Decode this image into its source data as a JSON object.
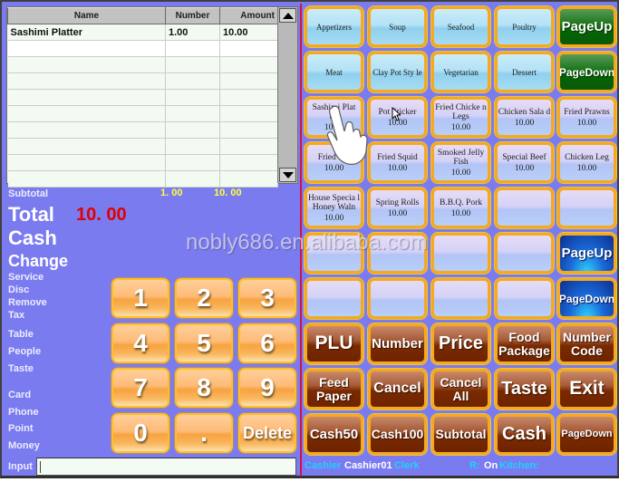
{
  "order_grid": {
    "columns": [
      "Name",
      "Number",
      "Amount"
    ],
    "rows": [
      {
        "name": "Sashimi Platter",
        "number": "1.00",
        "amount": "10.00"
      }
    ],
    "empty_rows": 9
  },
  "summary": {
    "subtotal_label": "Subtotal",
    "subtotal_number": "1. 00",
    "subtotal_amount": "10. 00",
    "total_label": "Total",
    "total_value": "10. 00",
    "cash_label": "Cash",
    "change_label": "Change"
  },
  "side_labels": [
    "Service",
    "Disc",
    "Remove",
    "Tax",
    "Table",
    "People",
    "Taste",
    "Card",
    "Phone",
    "Point",
    "Money"
  ],
  "numpad": [
    "1",
    "2",
    "3",
    "4",
    "5",
    "6",
    "7",
    "8",
    "9",
    "0",
    ".",
    "Delete"
  ],
  "input": {
    "label": "Input",
    "value": ""
  },
  "categories": [
    "Appetizers",
    "Soup",
    "Seafood",
    "Poultry",
    "Meat",
    "Clay Pot Sty le",
    "Vegetarian",
    "Dessert"
  ],
  "category_nav": {
    "page_up": "PageUp",
    "page_down": "PageDown"
  },
  "items": [
    {
      "name": "Sashimi Plat ter",
      "price": "10.00"
    },
    {
      "name": "Pot Sticker",
      "price": "10.00"
    },
    {
      "name": "Fried Chicke n Legs",
      "price": "10.00"
    },
    {
      "name": "Chicken Sala d",
      "price": "10.00"
    },
    {
      "name": "Fried Prawns",
      "price": "10.00"
    },
    {
      "name": "Fried ... s",
      "price": "10.00"
    },
    {
      "name": "Fried Squid",
      "price": "10.00"
    },
    {
      "name": "Smoked Jelly Fish",
      "price": "10.00"
    },
    {
      "name": "Special Beef",
      "price": "10.00"
    },
    {
      "name": "Chicken Leg",
      "price": "10.00"
    },
    {
      "name": "House Specia l Honey Waln",
      "price": "10.00"
    },
    {
      "name": "Spring Rolls",
      "price": "10.00"
    },
    {
      "name": "B.B.Q. Pork",
      "price": "10.00"
    }
  ],
  "item_nav": {
    "page_up": "PageUp",
    "page_down": "PageDown"
  },
  "functions": [
    [
      "PLU",
      "Number",
      "Price",
      "Food Package",
      "Number Code"
    ],
    [
      "Feed Paper",
      "Cancel",
      "Cancel All",
      "Taste",
      "Exit"
    ],
    [
      "Cash50",
      "Cash100",
      "Subtotal",
      "Cash",
      "PageDown"
    ]
  ],
  "status_bar": {
    "cashier_label": "Cashier",
    "cashier_value": "Cashier01",
    "clerk_label": "Clerk",
    "r_label": "R:",
    "r_value": "On",
    "kitchen_label": "Kitchen:"
  },
  "watermark": "nobly686.en.alibaba.com",
  "colors": {
    "background": "#7b7bf0",
    "total_value": "#e00000",
    "subtotal_values": "#ffff40",
    "status_label": "#20d0ff",
    "divider": "#d0104a",
    "button_border": "#f6a91e"
  }
}
